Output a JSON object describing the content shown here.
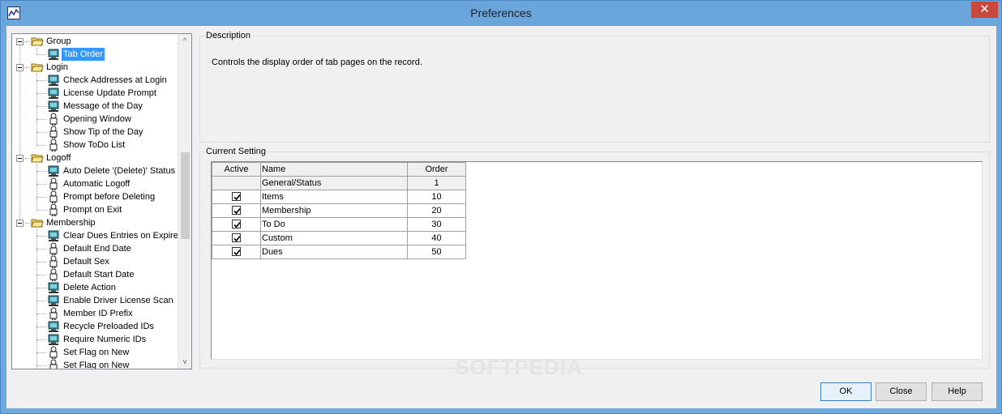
{
  "window": {
    "title": "Preferences",
    "close_glyph": "✕"
  },
  "tree": {
    "items": [
      {
        "label": "Group",
        "kind": "folder",
        "level": 0
      },
      {
        "label": "Tab Order",
        "kind": "monitor",
        "level": 1,
        "selected": true
      },
      {
        "label": "Login",
        "kind": "folder",
        "level": 0
      },
      {
        "label": "Check Addresses at Login",
        "kind": "monitor",
        "level": 1
      },
      {
        "label": "License Update Prompt",
        "kind": "monitor",
        "level": 1
      },
      {
        "label": "Message of the Day",
        "kind": "monitor",
        "level": 1
      },
      {
        "label": "Opening Window",
        "kind": "person",
        "level": 1
      },
      {
        "label": "Show Tip of the Day",
        "kind": "person",
        "level": 1
      },
      {
        "label": "Show ToDo List",
        "kind": "person",
        "level": 1
      },
      {
        "label": "Logoff",
        "kind": "folder",
        "level": 0
      },
      {
        "label": "Auto Delete '(Delete)' Status",
        "kind": "monitor",
        "level": 1
      },
      {
        "label": "Automatic Logoff",
        "kind": "person",
        "level": 1
      },
      {
        "label": "Prompt before Deleting",
        "kind": "person",
        "level": 1
      },
      {
        "label": "Prompt on Exit",
        "kind": "person",
        "level": 1
      },
      {
        "label": "Membership",
        "kind": "folder",
        "level": 0
      },
      {
        "label": "Clear Dues Entries on Expire",
        "kind": "monitor",
        "level": 1
      },
      {
        "label": "Default End Date",
        "kind": "person",
        "level": 1
      },
      {
        "label": "Default Sex",
        "kind": "person",
        "level": 1
      },
      {
        "label": "Default Start Date",
        "kind": "person",
        "level": 1
      },
      {
        "label": "Delete Action",
        "kind": "monitor",
        "level": 1
      },
      {
        "label": "Enable Driver License Scan",
        "kind": "monitor",
        "level": 1
      },
      {
        "label": "Member ID Prefix",
        "kind": "person",
        "level": 1
      },
      {
        "label": "Recycle Preloaded IDs",
        "kind": "monitor",
        "level": 1
      },
      {
        "label": "Require Numeric IDs",
        "kind": "monitor",
        "level": 1
      },
      {
        "label": "Set Flag on New",
        "kind": "person",
        "level": 1
      },
      {
        "label": "Set Flag on New",
        "kind": "person",
        "level": 1
      }
    ],
    "scroll_up_glyph": "^",
    "scroll_down_glyph": "v"
  },
  "description": {
    "label": "Description",
    "text": "Controls the display order of tab pages on the record."
  },
  "current_setting": {
    "label": "Current Setting",
    "columns": [
      "Active",
      "Name",
      "Order"
    ],
    "rows": [
      {
        "active": null,
        "name": "General/Status",
        "order": "1"
      },
      {
        "active": true,
        "name": "Items",
        "order": "10"
      },
      {
        "active": true,
        "name": "Membership",
        "order": "20"
      },
      {
        "active": true,
        "name": "To Do",
        "order": "30"
      },
      {
        "active": true,
        "name": "Custom",
        "order": "40"
      },
      {
        "active": true,
        "name": "Dues",
        "order": "50"
      }
    ]
  },
  "watermark": "SOFTPEDIA",
  "buttons": {
    "ok": "OK",
    "close": "Close",
    "help": "Help"
  }
}
